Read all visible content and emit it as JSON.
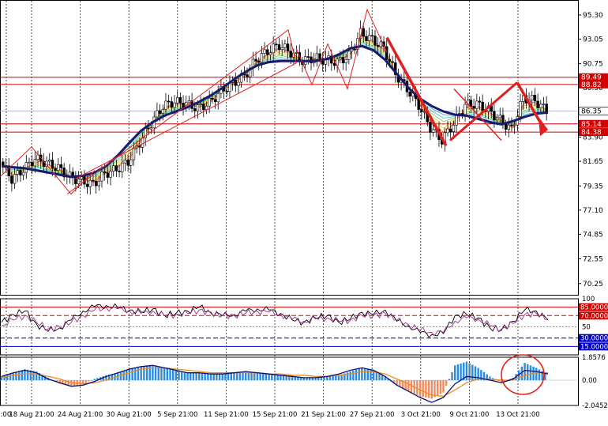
{
  "chart_data": [
    {
      "type": "candlestick",
      "instrument_note": "",
      "price_axis_ticks": [
        "95.30",
        "93.05",
        "90.75",
        "88.50",
        "86.25",
        "83.90",
        "81.65",
        "79.35",
        "77.10",
        "74.85",
        "72.55",
        "70.25"
      ],
      "price_range": [
        69.2,
        96.4
      ],
      "horizontal_levels": [
        {
          "label": "89.49",
          "value": 89.49,
          "color": "#d40000"
        },
        {
          "label": "88.82",
          "value": 88.82,
          "color": "#d40000"
        },
        {
          "label": "85.14",
          "value": 85.14,
          "color": "#d40000"
        },
        {
          "label": "84.38",
          "value": 84.38,
          "color": "#d40000"
        }
      ],
      "current_price": {
        "label": "86.35",
        "value": 86.35
      },
      "x_labels": [
        "18 Aug 21:00",
        "24 Aug 21:00",
        "30 Aug 21:00",
        "5 Sep 21:00",
        "11 Sep 21:00",
        "15 Sep 21:00",
        "21 Sep 21:00",
        "27 Sep 21:00",
        "3 Oct 21:00",
        "9 Oct 21:00",
        "13 Oct 21:00"
      ],
      "x_label_left_cut": "21:00",
      "close_path": [
        81.6,
        80.0,
        80.9,
        81.9,
        81.5,
        81.0,
        80.2,
        79.8,
        79.5,
        80.5,
        80.9,
        81.6,
        83.4,
        85.2,
        86.8,
        87.2,
        87.0,
        86.6,
        87.1,
        88.2,
        88.9,
        89.6,
        91.1,
        91.9,
        92.5,
        91.8,
        91.0,
        91.3,
        91.1,
        90.9,
        91.5,
        93.6,
        93.0,
        92.2,
        89.8,
        88.4,
        86.9,
        84.8,
        83.6,
        85.2,
        86.9,
        87.0,
        86.4,
        85.5,
        84.6,
        87.6,
        87.3,
        86.35
      ],
      "ma_slow": [
        81.2,
        81.1,
        81.0,
        80.8,
        80.6,
        80.4,
        80.2,
        80.3,
        80.6,
        81.2,
        82.2,
        83.4,
        84.5,
        85.3,
        85.9,
        86.3,
        86.7,
        87.2,
        87.8,
        88.5,
        89.3,
        90.0,
        90.6,
        90.9,
        91.0,
        91.0,
        91.0,
        91.0,
        91.2,
        91.6,
        92.2,
        92.4,
        92.0,
        91.1,
        89.8,
        88.5,
        87.5,
        86.8,
        86.3,
        86.0,
        85.9,
        85.6,
        85.3,
        85.1,
        85.4,
        85.8,
        86.1,
        86.2
      ],
      "annotations": [
        {
          "kind": "circle",
          "text": ""
        },
        {
          "kind": "arrow-down",
          "text": ""
        }
      ]
    },
    {
      "type": "line",
      "panel": "oscillator",
      "y_ticks": [
        "100",
        "85.0000",
        "70.0000",
        "50",
        "30.0000",
        "15.0000"
      ],
      "levels": [
        85,
        70,
        50,
        30,
        15
      ],
      "series": [
        {
          "values": [
            58,
            72,
            78,
            55,
            42,
            48,
            62,
            78,
            86,
            88,
            84,
            80,
            76,
            82,
            70,
            74,
            78,
            85,
            76,
            70,
            72,
            78,
            82,
            80,
            74,
            62,
            58,
            66,
            70,
            58,
            64,
            76,
            72,
            80,
            60,
            52,
            40,
            36,
            38,
            70,
            72,
            66,
            48,
            44,
            60,
            80,
            78,
            62
          ]
        },
        {
          "values": [
            52,
            62,
            70,
            58,
            46,
            50,
            58,
            70,
            80,
            84,
            82,
            78,
            74,
            78,
            70,
            72,
            74,
            80,
            74,
            70,
            70,
            74,
            78,
            76,
            72,
            64,
            60,
            64,
            66,
            60,
            62,
            70,
            70,
            74,
            62,
            54,
            44,
            40,
            40,
            60,
            66,
            64,
            52,
            46,
            56,
            72,
            74,
            64
          ]
        }
      ]
    },
    {
      "type": "bar",
      "panel": "macd",
      "y_ticks": [
        "1.8576",
        "0.00",
        "-2.0452"
      ],
      "y_range": [
        -2.0452,
        1.8576
      ],
      "histogram": [
        0.3,
        0.6,
        0.9,
        0.7,
        0.2,
        -0.3,
        -0.5,
        -0.3,
        0.1,
        0.4,
        0.6,
        0.9,
        1.1,
        1.2,
        1.0,
        0.8,
        0.6,
        0.6,
        0.5,
        0.5,
        0.6,
        0.7,
        0.6,
        0.5,
        0.4,
        0.3,
        0.2,
        0.2,
        0.3,
        0.4,
        0.7,
        1.0,
        0.8,
        0.3,
        -0.4,
        -0.9,
        -1.3,
        -1.5,
        -1.0,
        1.2,
        1.5,
        1.0,
        0.3,
        -0.2,
        0.2,
        1.4,
        1.0,
        0.5
      ],
      "signal": [
        0.2,
        0.4,
        0.5,
        0.5,
        0.3,
        0.1,
        -0.2,
        -0.3,
        -0.2,
        0.0,
        0.3,
        0.6,
        0.9,
        1.0,
        1.0,
        0.9,
        0.8,
        0.7,
        0.6,
        0.6,
        0.6,
        0.6,
        0.6,
        0.5,
        0.5,
        0.4,
        0.4,
        0.3,
        0.3,
        0.4,
        0.5,
        0.7,
        0.7,
        0.5,
        0.1,
        -0.3,
        -0.8,
        -1.2,
        -1.3,
        -0.8,
        -0.2,
        0.1,
        0.1,
        0.0,
        0.0,
        0.4,
        0.6,
        0.6
      ],
      "macd_line": [
        0.3,
        0.6,
        0.8,
        0.6,
        0.1,
        -0.2,
        -0.5,
        -0.4,
        -0.1,
        0.3,
        0.6,
        0.9,
        1.1,
        1.2,
        1.0,
        0.8,
        0.6,
        0.6,
        0.5,
        0.5,
        0.6,
        0.7,
        0.6,
        0.5,
        0.4,
        0.3,
        0.2,
        0.2,
        0.3,
        0.5,
        0.8,
        1.0,
        0.8,
        0.3,
        -0.4,
        -0.9,
        -1.4,
        -1.8,
        -1.4,
        -0.3,
        0.3,
        0.2,
        0.0,
        -0.2,
        0.1,
        0.8,
        0.7,
        0.5
      ]
    }
  ],
  "colors": {
    "grid_dash": "#000000",
    "level_red": "#d40000",
    "level_box_bg": "#d40000",
    "current_box_bg": "#ffffff",
    "ma_slow": "#1a1a6e",
    "osc_level_blue": "#0000cc",
    "osc_line_1": "#000000",
    "osc_line_2": "#a0308a",
    "macd_pos": "#2a8be0",
    "macd_neg": "#f08a60",
    "macd_signal": "#f08a20",
    "macd_line": "#10106a",
    "annotation_red": "#e02020"
  }
}
